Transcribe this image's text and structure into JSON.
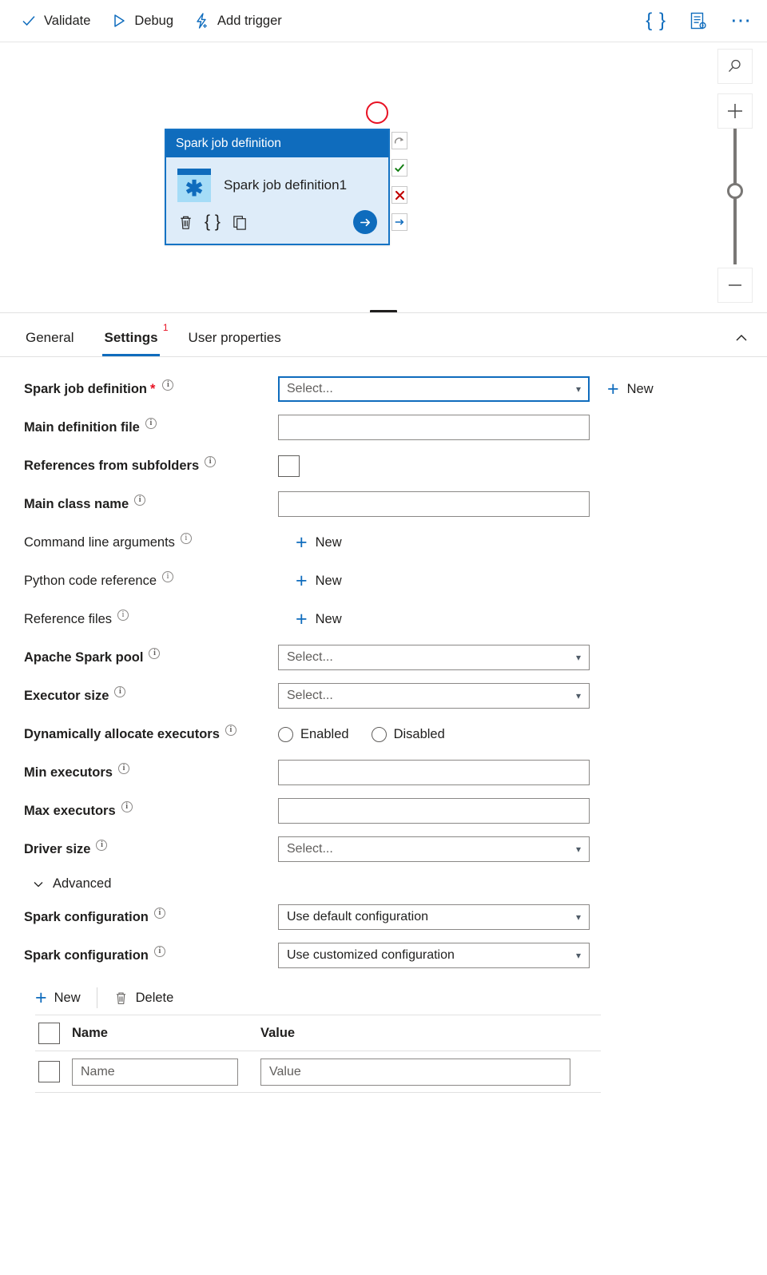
{
  "toolbar": {
    "validate": "Validate",
    "debug": "Debug",
    "add_trigger": "Add trigger",
    "code_icon": "code-braces-icon",
    "properties_icon": "properties-gear-icon",
    "more_icon": "ellipsis-icon"
  },
  "canvas": {
    "activity": {
      "header": "Spark job definition",
      "name": "Spark job definition1",
      "icon": "spark-job-definition-icon",
      "actions": {
        "delete": "trash-icon",
        "code": "code-braces-icon",
        "clone": "copy-icon",
        "run": "arrow-right-circle-icon"
      },
      "handles": [
        {
          "name": "skipped",
          "glyph": "↷"
        },
        {
          "name": "success",
          "glyph": "✔"
        },
        {
          "name": "failure",
          "glyph": "✘"
        },
        {
          "name": "completion",
          "glyph": "→"
        }
      ]
    },
    "zoom_controls": {
      "search": "search-icon",
      "zoom_in": "+",
      "zoom_out": "–",
      "fit": "fit-to-screen-icon"
    }
  },
  "panel": {
    "tabs": [
      {
        "label": "General",
        "active": false,
        "badge": ""
      },
      {
        "label": "Settings",
        "active": true,
        "badge": "1"
      },
      {
        "label": "User properties",
        "active": false,
        "badge": ""
      }
    ],
    "collapse_icon": "chevron-up-icon"
  },
  "form": {
    "select_placeholder": "Select...",
    "new_label": "New",
    "fields": {
      "spark_job_definition": {
        "label": "Spark job definition",
        "required": "*",
        "value": "Select...",
        "new": "New"
      },
      "main_definition_file": {
        "label": "Main definition file",
        "value": ""
      },
      "references_from_subfolders": {
        "label": "References from subfolders",
        "checked": false
      },
      "main_class_name": {
        "label": "Main class name",
        "value": ""
      },
      "command_line_arguments": {
        "label": "Command line arguments",
        "new": "New"
      },
      "python_code_reference": {
        "label": "Python code reference",
        "new": "New"
      },
      "reference_files": {
        "label": "Reference files",
        "new": "New"
      },
      "apache_spark_pool": {
        "label": "Apache Spark pool",
        "value": "Select..."
      },
      "executor_size": {
        "label": "Executor size",
        "value": "Select..."
      },
      "dynamically_allocate_executors": {
        "label": "Dynamically allocate executors",
        "options": [
          "Enabled",
          "Disabled"
        ],
        "selected": ""
      },
      "min_executors": {
        "label": "Min executors",
        "value": ""
      },
      "max_executors": {
        "label": "Max executors",
        "value": ""
      },
      "driver_size": {
        "label": "Driver size",
        "value": "Select..."
      }
    },
    "advanced": {
      "section_label": "Advanced",
      "spark_configuration_default": {
        "label": "Spark configuration",
        "value": "Use default configuration"
      },
      "spark_configuration_customized": {
        "label": "Spark configuration",
        "value": "Use customized configuration"
      }
    },
    "kv_table": {
      "new_label": "New",
      "delete_label": "Delete",
      "columns": [
        "Name",
        "Value"
      ],
      "rows": [
        {
          "name_placeholder": "Name",
          "value_placeholder": "Value",
          "name": "",
          "value": ""
        }
      ]
    }
  },
  "colors": {
    "accent": "#0f6cbd",
    "activity_header": "#0f6cbd",
    "activity_body": "#deecf9",
    "required": "#e81123",
    "success": "#107c10",
    "failure": "#c00000"
  }
}
